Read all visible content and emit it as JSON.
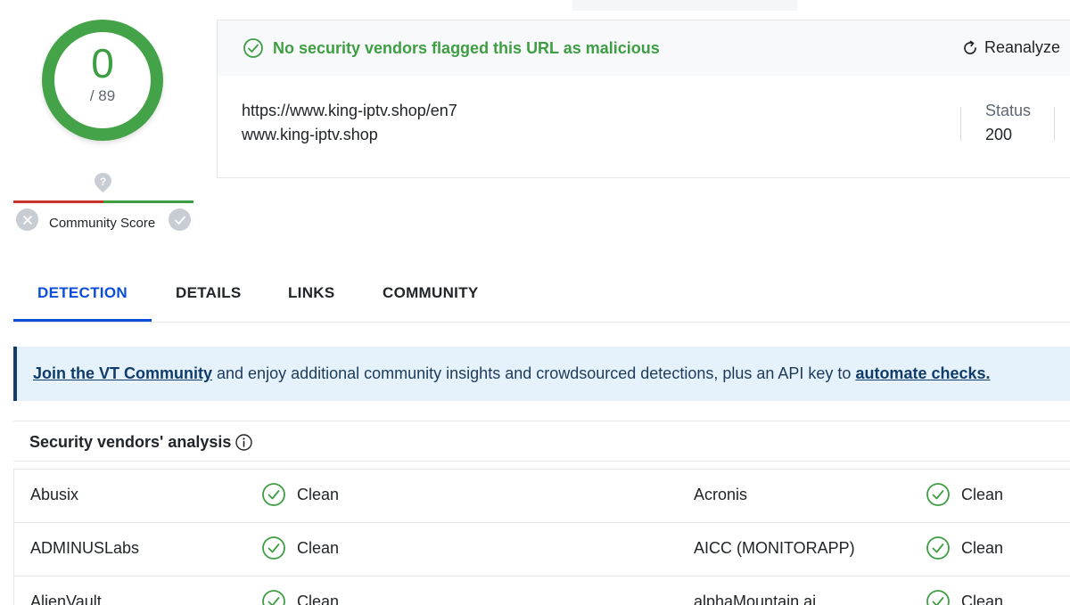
{
  "score": {
    "value": "0",
    "total": "/ 89",
    "ring_color": "#44a348"
  },
  "community": {
    "label": "Community Score",
    "question_icon": "question-marker-icon",
    "down_icon": "x-icon",
    "up_icon": "check-icon"
  },
  "header": {
    "verdict": "No security vendors flagged this URL as malicious",
    "verdict_color": "#3e9e43",
    "reanalyze_label": "Reanalyze",
    "url": "https://www.king-iptv.shop/en7",
    "domain": "www.king-iptv.shop",
    "status_label": "Status",
    "status_value": "200"
  },
  "tabs": [
    {
      "label": "DETECTION",
      "active": true
    },
    {
      "label": "DETAILS",
      "active": false
    },
    {
      "label": "LINKS",
      "active": false
    },
    {
      "label": "COMMUNITY",
      "active": false
    }
  ],
  "banner": {
    "link1": "Join the VT Community",
    "text": " and enjoy additional community insights and crowdsourced detections, plus an API key to ",
    "link2": "automate checks."
  },
  "vendors": {
    "title": "Security vendors' analysis",
    "rows": [
      {
        "left_name": "Abusix",
        "left_result": "Clean",
        "right_name": "Acronis",
        "right_result": "Clean"
      },
      {
        "left_name": "ADMINUSLabs",
        "left_result": "Clean",
        "right_name": "AICC (MONITORAPP)",
        "right_result": "Clean"
      },
      {
        "left_name": "AlienVault",
        "left_result": "Clean",
        "right_name": "alphaMountain.ai",
        "right_result": "Clean"
      }
    ]
  },
  "colors": {
    "accent": "#0b4dda",
    "clean": "#3e9e43",
    "banner_bg": "#e6f2fb"
  }
}
